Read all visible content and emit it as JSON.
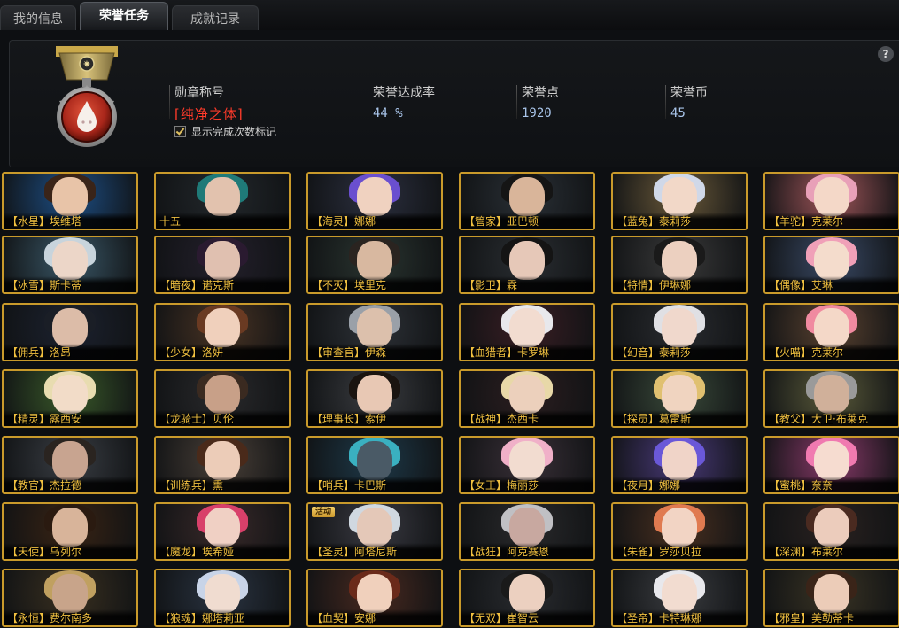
{
  "tabs": [
    {
      "label": "我的信息",
      "active": false
    },
    {
      "label": "荣誉任务",
      "active": true
    },
    {
      "label": "成就记录",
      "active": false
    }
  ],
  "panel": {
    "help_label": "?",
    "medal_title_label": "勋章称号",
    "medal_title_value": "[纯净之体]",
    "show_marker_label": "显示完成次数标记",
    "show_marker_checked": true,
    "completion_label": "荣誉达成率",
    "completion_value": "44 %",
    "points_label": "荣誉点",
    "points_value": "1920",
    "coins_label": "荣誉币",
    "coins_value": "45"
  },
  "colors": {
    "accent_gold": "#c99a2b",
    "title_red": "#ff3b2a",
    "value_blue": "#a9c5ea"
  },
  "characters": [
    {
      "name": "【水星】埃维塔",
      "bg": "#1d4f86",
      "hair": "#3a2418",
      "skin": "#e8c4a8"
    },
    {
      "name": "十五",
      "bg": "#23282c",
      "hair": "#1f7a78",
      "skin": "#e2c2ae"
    },
    {
      "name": "【海灵】娜娜",
      "bg": "#2c3040",
      "hair": "#6a4fcf",
      "skin": "#f0d2c0"
    },
    {
      "name": "【管家】亚巴顿",
      "bg": "#2a3036",
      "hair": "#151515",
      "skin": "#d9b59a"
    },
    {
      "name": "【蓝兔】泰莉莎",
      "bg": "#6b5a3a",
      "hair": "#d0d8e8",
      "skin": "#f2d8c8"
    },
    {
      "name": "【羊驼】克莱尔",
      "bg": "#a0565a",
      "hair": "#e8a0b8",
      "skin": "#f4d8c8"
    },
    {
      "name": "【冰雪】斯卡蒂",
      "bg": "#3a5868",
      "hair": "#c8d4dc",
      "skin": "#ecd6c8"
    },
    {
      "name": "【暗夜】诺克斯",
      "bg": "#24202c",
      "hair": "#2a1a30",
      "skin": "#e0c0b0"
    },
    {
      "name": "【不灭】埃里克",
      "bg": "#2a3530",
      "hair": "#2a2420",
      "skin": "#d8b8a0"
    },
    {
      "name": "【影卫】霖",
      "bg": "#2a2e32",
      "hair": "#141414",
      "skin": "#e6c8b8"
    },
    {
      "name": "【特情】伊琳娜",
      "bg": "#3a3a3a",
      "hair": "#1a1a1a",
      "skin": "#ecd0c0"
    },
    {
      "name": "【偶像】艾琳",
      "bg": "#3a4a66",
      "hair": "#f0a0b8",
      "skin": "#f4dccc"
    },
    {
      "name": "【佣兵】洛昂",
      "bg": "#1c2230",
      "hair": "#1a1e26",
      "skin": "#dcbca8"
    },
    {
      "name": "【少女】洛妍",
      "bg": "#4a3424",
      "hair": "#6a3a22",
      "skin": "#f0d0bc"
    },
    {
      "name": "【审查官】伊森",
      "bg": "#2e3238",
      "hair": "#9aa0a8",
      "skin": "#dcc0ac"
    },
    {
      "name": "【血猎者】卡罗琳",
      "bg": "#3a1e24",
      "hair": "#e8e8ec",
      "skin": "#f2dcd0"
    },
    {
      "name": "【幻音】泰莉莎",
      "bg": "#2a2c30",
      "hair": "#e0e0e4",
      "skin": "#f0d8cc"
    },
    {
      "name": "【火喵】克莱尔",
      "bg": "#5a4230",
      "hair": "#f08aa0",
      "skin": "#f4d8c8"
    },
    {
      "name": "【精灵】露西安",
      "bg": "#3a5a2a",
      "hair": "#e8dcb0",
      "skin": "#f2dcc8"
    },
    {
      "name": "【龙骑士】贝伦",
      "bg": "#2a2a2c",
      "hair": "#3a2a20",
      "skin": "#c8a088"
    },
    {
      "name": "【理事长】索伊",
      "bg": "#3a3c40",
      "hair": "#1a1410",
      "skin": "#e8c8b4"
    },
    {
      "name": "【战神】杰西卡",
      "bg": "#2c1e20",
      "hair": "#e8d8a8",
      "skin": "#ecd0bc"
    },
    {
      "name": "【探员】葛雷斯",
      "bg": "#3a4a3a",
      "hair": "#e0c070",
      "skin": "#f0d4c0"
    },
    {
      "name": "【教父】大卫·布莱克",
      "bg": "#5a5a3a",
      "hair": "#9a9a9a",
      "skin": "#d0b09a"
    },
    {
      "name": "【教官】杰拉德",
      "bg": "#3a3e44",
      "hair": "#2a2420",
      "skin": "#c8a490"
    },
    {
      "name": "【训练兵】熏",
      "bg": "#4a4038",
      "hair": "#4a2a1a",
      "skin": "#ecccb8"
    },
    {
      "name": "【哨兵】卡巴斯",
      "bg": "#1e3a4a",
      "hair": "#3ab0c0",
      "skin": "#4a5a66"
    },
    {
      "name": "【女王】梅丽莎",
      "bg": "#3a3038",
      "hair": "#f0b0c8",
      "skin": "#f2dcd0"
    },
    {
      "name": "【夜月】娜娜",
      "bg": "#4a3a7a",
      "hair": "#6a58d8",
      "skin": "#f0d4c8"
    },
    {
      "name": "【蜜桃】奈奈",
      "bg": "#8a3a6a",
      "hair": "#f07ab0",
      "skin": "#f6dcd0"
    },
    {
      "name": "【天使】乌列尔",
      "bg": "#3a2414",
      "hair": "#2a1a10",
      "skin": "#d8b49a"
    },
    {
      "name": "【魔龙】埃希娅",
      "bg": "#3a2a2a",
      "hair": "#d8406a",
      "skin": "#f0d0c4"
    },
    {
      "name": "【圣灵】阿塔尼斯",
      "bg": "#3a3a42",
      "hair": "#d0d8e0",
      "skin": "#e4c8b8",
      "badge": "活动"
    },
    {
      "name": "【战狂】阿克赛恩",
      "bg": "#2a2a2c",
      "hair": "#c0c0c4",
      "skin": "#c8a8a0"
    },
    {
      "name": "【朱雀】罗莎贝拉",
      "bg": "#4a3020",
      "hair": "#e07a50",
      "skin": "#f2d4c4"
    },
    {
      "name": "【深渊】布莱尔",
      "bg": "#2a2220",
      "hair": "#4a2a20",
      "skin": "#ecccbc"
    },
    {
      "name": "【永恒】费尔南多",
      "bg": "#3a3020",
      "hair": "#c0a060",
      "skin": "#c8a48a"
    },
    {
      "name": "【狼魂】娜塔莉亚",
      "bg": "#2a3442",
      "hair": "#c8d4e8",
      "skin": "#f0dcd0"
    },
    {
      "name": "【血契】安娜",
      "bg": "#4a2a20",
      "hair": "#6a2a1a",
      "skin": "#f0d0bc"
    },
    {
      "name": "【无双】崔智云",
      "bg": "#2a2c30",
      "hair": "#1a1a1a",
      "skin": "#ecd0c0"
    },
    {
      "name": "【圣帝】卡特琳娜",
      "bg": "#3a3c40",
      "hair": "#e8e8ec",
      "skin": "#f2dcd0"
    },
    {
      "name": "【邪皇】美勒蒂卡",
      "bg": "#3a3424",
      "hair": "#3a2418",
      "skin": "#ecccb8"
    }
  ]
}
